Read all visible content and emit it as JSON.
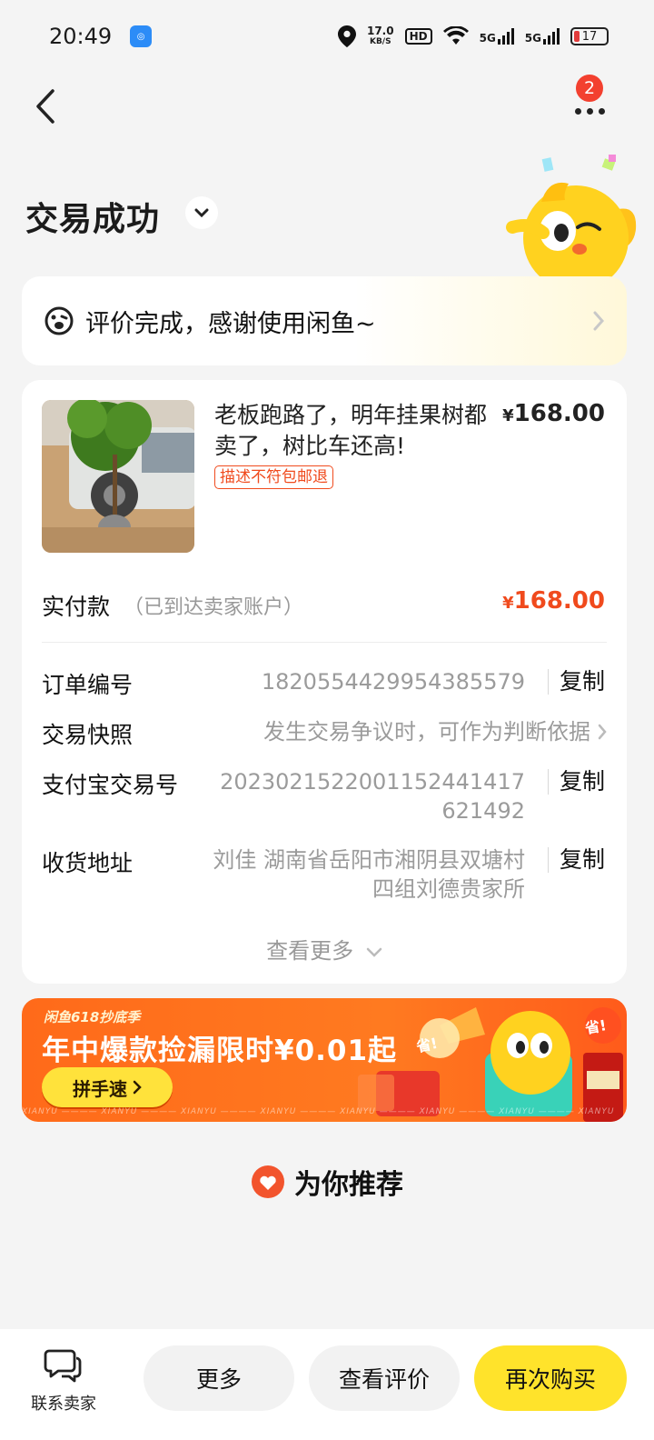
{
  "status_bar": {
    "time": "20:49",
    "net_speed_value": "17.0",
    "net_speed_unit": "KB/S",
    "hd_label": "HD",
    "signal1": "5G",
    "signal2": "5G",
    "battery": "17"
  },
  "header": {
    "more_badge": "2",
    "title": "交易成功"
  },
  "review_banner": {
    "text": "评价完成，感谢使用闲鱼~"
  },
  "product": {
    "title": "老板跑路了，明年挂果树都卖了，树比车还高!",
    "price_symbol": "¥",
    "price": "168.00",
    "tag": "描述不符包邮退"
  },
  "payment": {
    "label": "实付款",
    "note": "（已到达卖家账户）",
    "symbol": "¥",
    "amount": "168.00"
  },
  "details": {
    "order_no_label": "订单编号",
    "order_no": "1820554429954385579",
    "snapshot_label": "交易快照",
    "snapshot_value": "发生交易争议时，可作为判断依据",
    "alipay_label": "支付宝交易号",
    "alipay_line1": "202302152200115244141 7",
    "alipay_line1_clean": "2023021522001152441417",
    "alipay_line2": "621492",
    "address_label": "收货地址",
    "address_line1": "刘佳 湖南省岳阳市湘阴县双塘村",
    "address_line2": "四组刘德贵家所",
    "copy": "复制",
    "view_more": "查看更多"
  },
  "promo": {
    "tag": "闲鱼618抄底季",
    "title": "年中爆款捡漏限时¥0.01起",
    "button": "拼手速",
    "strip": "XIANYU ———— XIANYU ———— XIANYU ———— XIANYU ———— XIANYU ———— XIANYU ———— XIANYU ———— XIANYU",
    "sticker1": "省!",
    "sticker2": "省!"
  },
  "recommend": {
    "title": "为你推荐"
  },
  "bottom_bar": {
    "contact": "联系卖家",
    "more": "更多",
    "view_review": "查看评价",
    "buy_again": "再次购买"
  },
  "colors": {
    "accent_orange": "#f04a1d",
    "brand_yellow": "#ffe32b",
    "badge_red": "#f3402f"
  }
}
